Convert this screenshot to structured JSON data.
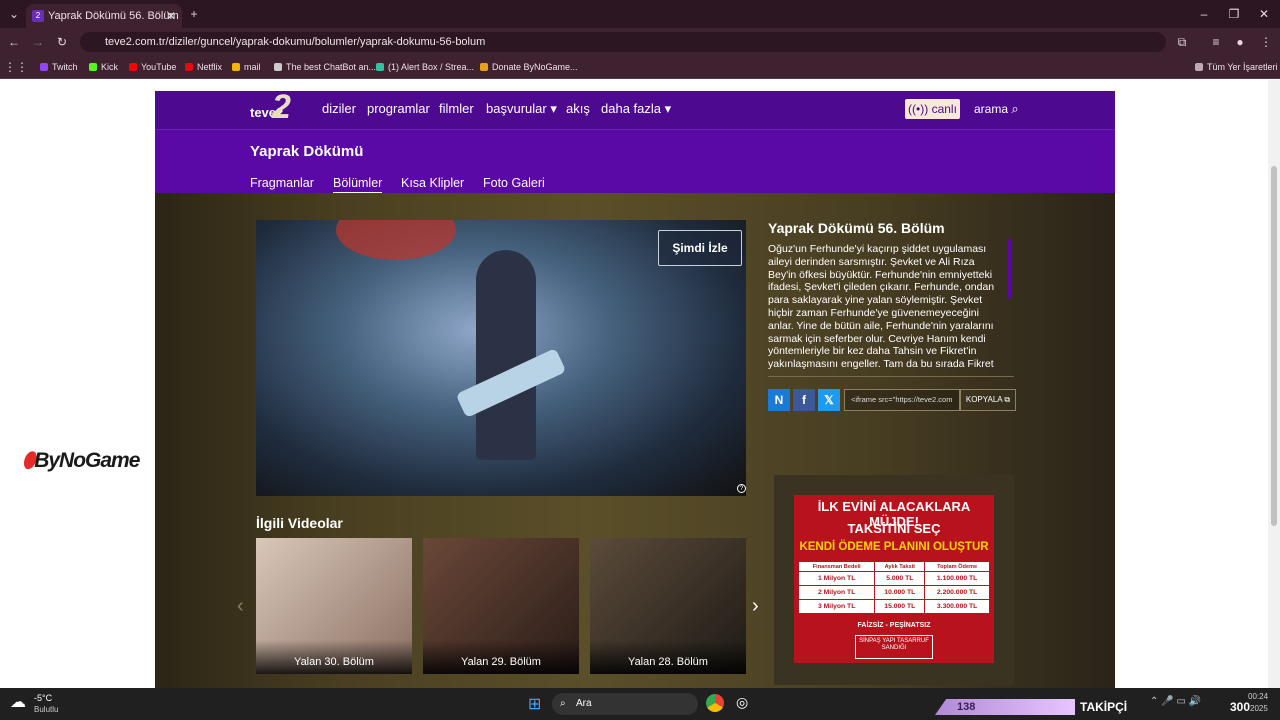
{
  "browser": {
    "tab_title": "Yaprak Dökümü 56. Bölüm",
    "url": "teve2.com.tr/diziler/guncel/yaprak-dokumu/bolumler/yaprak-dokumu-56-bolum",
    "bookmarks": [
      "Twitch",
      "Kick",
      "YouTube",
      "Netflix",
      "mail",
      "The best ChatBot an...",
      "(1) Alert Box / Strea...",
      "Donate ByNoGame..."
    ],
    "bookmarks_all": "Tüm Yer İşaretleri"
  },
  "site": {
    "logo": "teve2",
    "nav": [
      "diziler",
      "programlar",
      "filmler",
      "başvurular",
      "akış",
      "daha fazla"
    ],
    "live_label": "canlı",
    "search_label": "arama",
    "show_title": "Yaprak Dökümü",
    "subnav": [
      "Fragmanlar",
      "Bölümler",
      "Kısa Klipler",
      "Foto Galeri"
    ]
  },
  "episode": {
    "watch_label": "Şimdi İzle",
    "title": "Yaprak Dökümü 56. Bölüm",
    "description": "Oğuz'un Ferhunde'yi kaçırıp şiddet uygulaması aileyi derinden sarsmıştır. Şevket ve Ali Rıza Bey'in öfkesi büyüktür. Ferhunde'nin emniyetteki ifadesi, Şevket'i çileden çıkarır. Ferhunde, ondan para saklayarak yine yalan söylemiştir. Şevket hiçbir zaman Ferhunde'ye güvenemeyeceğini anlar. Yine de bütün aile, Ferhunde'nin yaralarını sarmak için seferber olur. Cevriye Hanım kendi yöntemleriyle bir kez daha Tahsin ve Fikret'in yakınlaşmasını engeller. Tam da bu sırada Fikret",
    "embed_code": "<iframe src=\"https://teve2.com",
    "copy_label": "KOPYALA"
  },
  "ad": {
    "line1": "İLK EVİNİ ALACAKLARA MÜJDE!",
    "line2": "TAKSİTİNİ SEÇ",
    "line3": "KENDİ ÖDEME PLANINI OLUŞTUR",
    "headers": [
      "Finansman Bedeli",
      "Aylık Taksit",
      "Toplam Ödeme"
    ],
    "rows": [
      [
        "1 Milyon TL",
        "5.000 TL",
        "1.100.000 TL"
      ],
      [
        "2 Milyon TL",
        "10.000 TL",
        "2.200.000 TL"
      ],
      [
        "3 Milyon TL",
        "15.000 TL",
        "3.300.000 TL"
      ]
    ],
    "tagline": "FAİZSİZ - PEŞİNATSIZ",
    "brand": "SİNPAŞ YAPI TASARRUF SANDIĞI"
  },
  "related": {
    "heading": "İlgili Videolar",
    "items": [
      "Yalan 30. Bölüm",
      "Yalan 29. Bölüm",
      "Yalan 28. Bölüm"
    ]
  },
  "overlay": {
    "logo_text": "ByNoGame",
    "followers": "138",
    "followers_label": "TAKİPÇİ",
    "goal": "300"
  },
  "taskbar": {
    "weather_temp": "-5°C",
    "weather_desc": "Bulutlu",
    "search": "Ara",
    "time": "00:24",
    "date": "2025"
  }
}
